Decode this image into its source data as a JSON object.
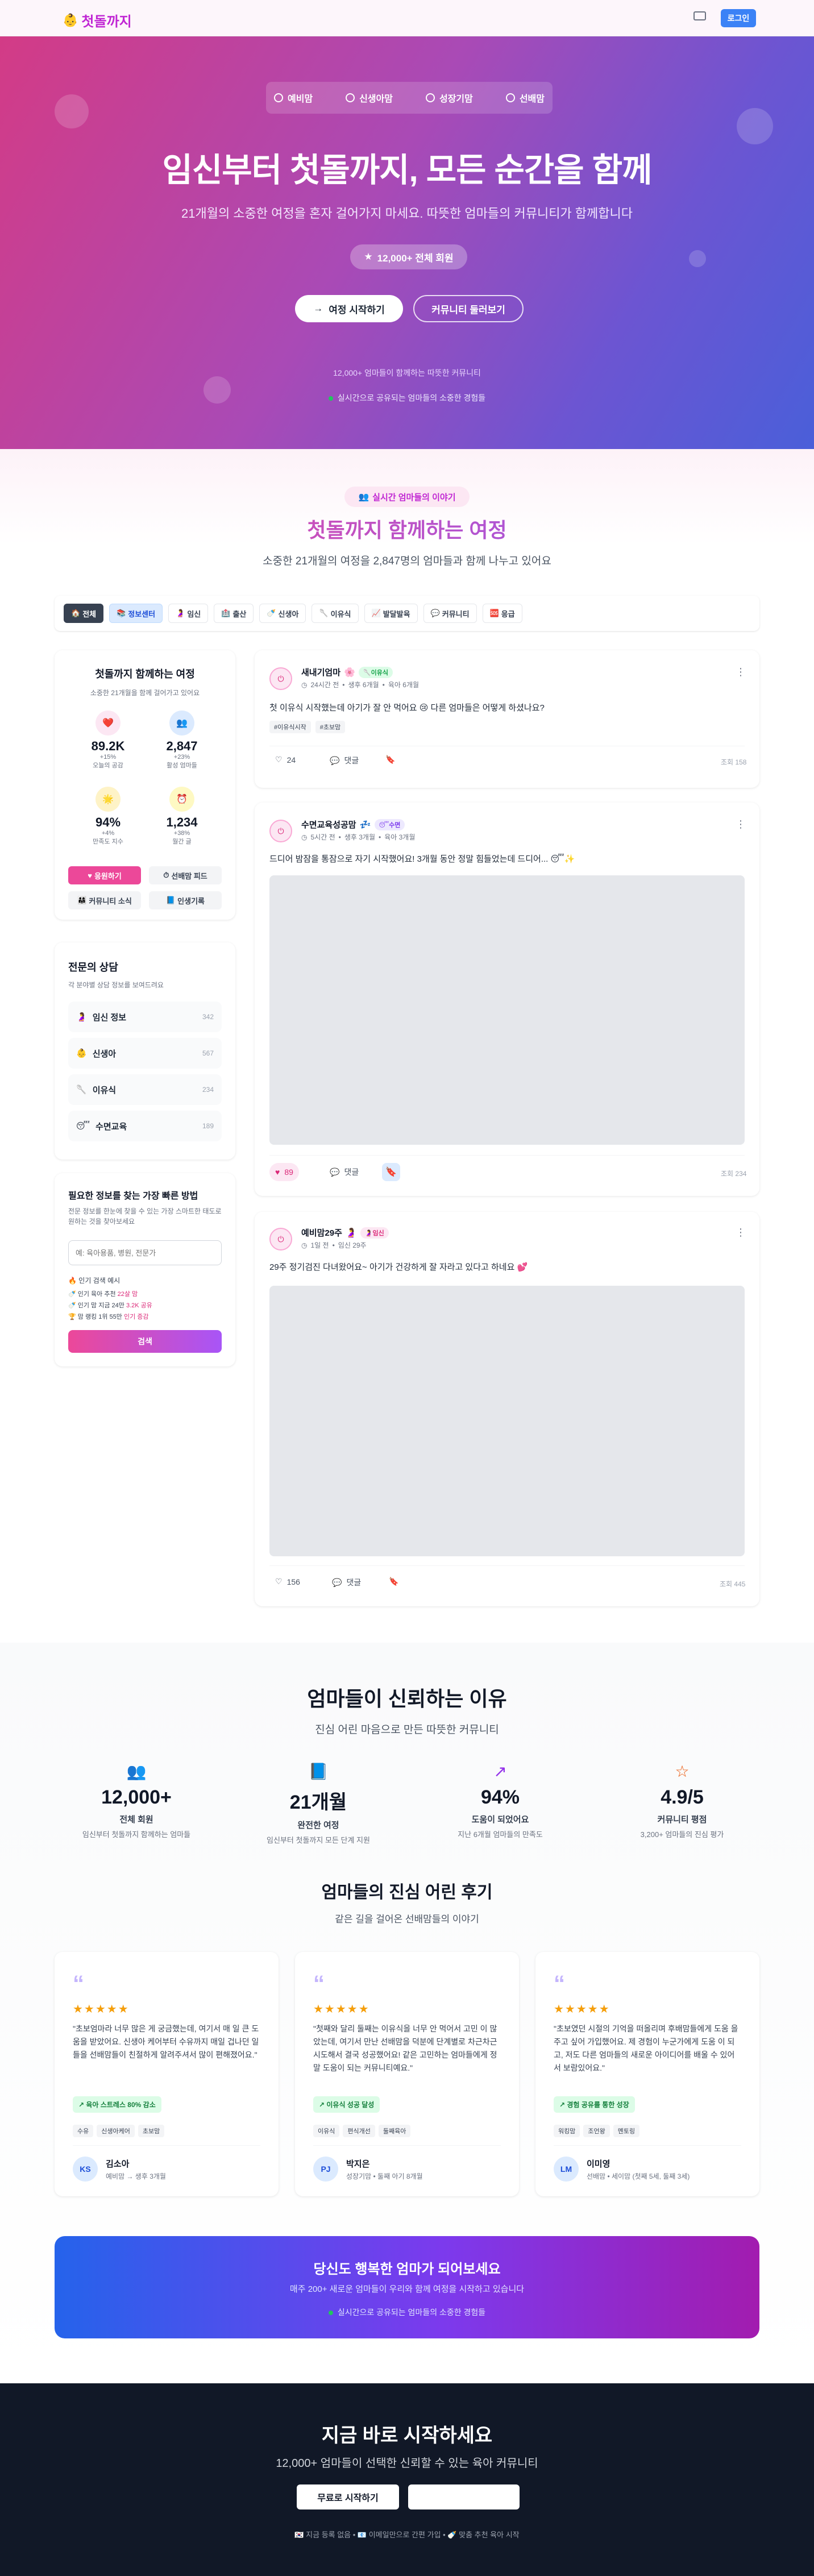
{
  "header": {
    "logo_emoji": "👶",
    "logo_text": "첫돌까지",
    "login_label": "로그인"
  },
  "hero": {
    "nav": [
      "예비맘",
      "신생아맘",
      "성장기맘",
      "선배맘"
    ],
    "title": "임신부터 첫돌까지, 모든 순간을 함께",
    "subtitle": "21개월의 소중한 여정을 혼자 걸어가지 마세요. 따뜻한 엄마들의 커뮤니티가 함께합니다",
    "member_badge": "12,000+ 전체 회원",
    "start_label": "여정 시작하기",
    "browse_label": "커뮤니티 둘러보기",
    "trust_line": "12,000+ 엄마들이 함께하는 따뜻한 커뮤니티",
    "live_line": "실시간으로 공유되는 엄마들의 소중한 경험들"
  },
  "journey": {
    "live_badge": "실시간 엄마들의 이야기",
    "title": "첫돌까지 함께하는 여정",
    "subtitle": "소중한 21개월의 여정을 2,847명의 엄마들과 함께 나누고 있어요",
    "categories": [
      {
        "emoji": "🏠",
        "label": "전체"
      },
      {
        "emoji": "📚",
        "label": "정보센터"
      },
      {
        "emoji": "🤰",
        "label": "임신"
      },
      {
        "emoji": "🏥",
        "label": "출산"
      },
      {
        "emoji": "🍼",
        "label": "신생아"
      },
      {
        "emoji": "🥄",
        "label": "이유식"
      },
      {
        "emoji": "📈",
        "label": "발달발육"
      },
      {
        "emoji": "💬",
        "label": "커뮤니티"
      },
      {
        "emoji": "🆘",
        "label": "응급"
      }
    ]
  },
  "sidebar": {
    "journey_card": {
      "title": "첫돌까지 함께하는 여정",
      "subtitle": "소중한 21개월을 함께 걸어가고 있어요",
      "stats": [
        {
          "emoji": "❤️",
          "value": "89.2K",
          "delta": "+15%",
          "label": "오늘의 공감"
        },
        {
          "emoji": "👥",
          "value": "2,847",
          "delta": "+23%",
          "label": "활성 엄마들"
        },
        {
          "emoji": "🌟",
          "value": "94%",
          "delta": "+4%",
          "label": "만족도 지수"
        },
        {
          "emoji": "⏰",
          "value": "1,234",
          "delta": "+38%",
          "label": "월간 글"
        }
      ],
      "buttons": [
        "응원하기",
        "선배맘 피드",
        "커뮤니티 소식",
        "인생기록"
      ]
    },
    "expert_card": {
      "title": "전문의 상담",
      "subtitle": "각 분야별 상담 정보를 보여드려요",
      "items": [
        {
          "emoji": "🤰",
          "label": "임신 정보",
          "count": "342"
        },
        {
          "emoji": "👶",
          "label": "신생아",
          "count": "567"
        },
        {
          "emoji": "🥄",
          "label": "이유식",
          "count": "234"
        },
        {
          "emoji": "😴",
          "label": "수면교육",
          "count": "189"
        }
      ]
    },
    "search_card": {
      "title": "필요한 정보를 찾는 가장 빠른 방법",
      "subtitle": "전문 정보를 한눈에 찾을 수 있는 가장 스마트한 태도로 원하는 것을 찾아보세요",
      "placeholder": "예: 육아용품, 병원, 전문가",
      "popular_label": "🔥 인기 검색 예시",
      "examples": [
        {
          "emoji": "🍼",
          "text": "인기 육아 추천",
          "highlight": "22살 맘"
        },
        {
          "emoji": "🍼",
          "text": "인기 맘 지금 24만",
          "highlight": "3.2K 공유"
        },
        {
          "emoji": "🏆",
          "text": "맘 랭킹 1위 55만",
          "highlight": "인기 증감"
        }
      ],
      "search_button": "검색"
    }
  },
  "posts": [
    {
      "name": "새내기엄마",
      "name_emoji": "🌸",
      "tag": "이유식",
      "tag_color": "#16a34a",
      "tag_bg": "#dcfce7",
      "time": "24시간 전",
      "stage": "생후 6개월",
      "group": "육아 6개월",
      "body": "첫 이유식 시작했는데 아기가 잘 안 먹어요 😢 다른 엄마들은 어떻게 하셨나요?",
      "tags": [
        "#이유식시작",
        "#초보맘"
      ],
      "likes": "24",
      "comment_label": "댓글",
      "views": "조회 158"
    },
    {
      "name": "수면교육성공맘",
      "name_emoji": "💤",
      "tag": "수면",
      "tag_color": "#7c3aed",
      "tag_bg": "#ede9fe",
      "time": "5시간 전",
      "stage": "생후 3개월",
      "group": "육아 3개월",
      "body": "드디어 밤잠을 통잠으로 자기 시작했어요! 3개월 동안 정말 힘들었는데 드디어... 😴✨",
      "likes": "89",
      "comment_label": "댓글",
      "views": "조회 234"
    },
    {
      "name": "예비맘29주",
      "name_emoji": "🤰",
      "tag": "임신",
      "tag_color": "#db2777",
      "tag_bg": "#fce7f3",
      "time": "1일 전",
      "stage": "임신 29주",
      "body": "29주 정기검진 다녀왔어요~ 아기가 건강하게 잘 자라고 있다고 하네요 💕",
      "likes": "156",
      "comment_label": "댓글",
      "views": "조회 445"
    }
  ],
  "trust": {
    "title": "엄마들이 신뢰하는 이유",
    "subtitle": "진심 어린 마음으로 만든 따뜻한 커뮤니티",
    "stats": [
      {
        "icon": "users-icon",
        "color": "#db2777",
        "value": "12,000+",
        "label": "전체 회원",
        "sub": "임신부터 첫돌까지 함께하는 엄마들"
      },
      {
        "icon": "book-icon",
        "color": "#2563eb",
        "value": "21개월",
        "label": "완전한 여정",
        "sub": "임신부터 첫돌까지 모든 단계 지원"
      },
      {
        "icon": "trending-icon",
        "color": "#9333ea",
        "value": "94%",
        "label": "도움이 되었어요",
        "sub": "지난 6개월 엄마들의 만족도"
      },
      {
        "icon": "star-icon",
        "color": "#ea580c",
        "value": "4.9/5",
        "label": "커뮤니티 평점",
        "sub": "3,200+ 엄마들의 진심 평가"
      }
    ]
  },
  "reviews": {
    "title": "엄마들의 진심 어린 후기",
    "subtitle": "같은 길을 걸어온 선배맘들의 이야기",
    "items": [
      {
        "stars": "★★★★★",
        "text": "\"초보엄마라 너무 많은 게 궁금했는데, 여기서 매 일 큰 도움을 받았어요. 신생아 케어부터 수유까지 매일 겁나던 일들을 선배맘들이 친절하게 알려주셔서 많이 편해졌어요.\"",
        "badge": "육아 스트레스 80% 감소",
        "tags": [
          "수유",
          "신생아케어",
          "초보맘"
        ],
        "initials": "KS",
        "name": "김소아",
        "info": "예비맘 → 생후 3개월"
      },
      {
        "stars": "★★★★★",
        "text": "\"첫째와 달리 둘째는 이유식을 너무 안 먹어서 고민 이 많았는데, 여기서 만난 선배맘을 덕분에 단계별로 차근차근 시도해서 결국 성공했어요! 같은 고민하는 엄마들에게 정말 도움이 되는 커뮤니티예요.\"",
        "badge": "이유식 성공 달성",
        "tags": [
          "이유식",
          "편식개선",
          "둘째육아"
        ],
        "initials": "PJ",
        "name": "박지은",
        "info": "성장기맘 • 둘째 아기 8개월"
      },
      {
        "stars": "★★★★★",
        "text": "\"초보였던 시절의 기억을 떠올리며 후배맘들에게 도움 을 주고 싶어 가입했어요. 제 경험이 누군가에게 도움 이 되고, 저도 다른 엄마들의 새로운 아이디어를 배울 수 있어서 보람있어요.\"",
        "badge": "경험 공유를 통한 성장",
        "tags": [
          "워킹맘",
          "조언왕",
          "멘토링"
        ],
        "initials": "LM",
        "name": "이미영",
        "info": "선배맘 • 세이맘 (첫째 5세, 둘째 3세)"
      }
    ]
  },
  "cta": {
    "title": "당신도 행복한 엄마가 되어보세요",
    "subtitle": "매주 200+ 새로운 엄마들이 우리와 함께 여정을 시작하고 있습니다",
    "live": "실시간으로 공유되는 엄마들의 소중한 경험들"
  },
  "footer": {
    "title": "지금 바로 시작하세요",
    "subtitle": "12,000+ 엄마들이 선택한 신뢰할 수 있는 육아 커뮤니티",
    "start_label": "무료로 시작하기",
    "notes": "🇰🇷 지금 등록 없음  •  📧 이메일만으로 간편 가입  •  🍼 맞춤 추천 육아 시작"
  },
  "colors": {
    "brand_pink": "#db2777",
    "brand_purple": "#7c3aed",
    "login_blue": "#3b82f6"
  }
}
